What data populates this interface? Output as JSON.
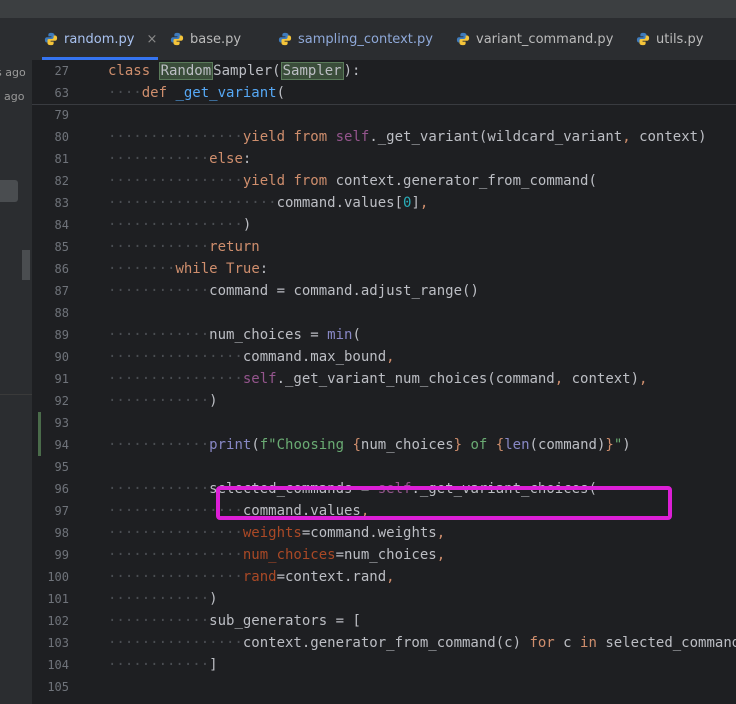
{
  "sidebar": {
    "ago_1": "s ago",
    "ago_2": "ago"
  },
  "tabs": [
    {
      "label": "random.py",
      "active": true,
      "close": "×"
    },
    {
      "label": "base.py"
    },
    {
      "label": "sampling_context.py"
    },
    {
      "label": "variant_command.py"
    },
    {
      "label": "utils.py"
    }
  ],
  "sticky": [
    {
      "num": "27",
      "text": "class RandomSampler(Sampler):"
    },
    {
      "num": "63",
      "text": "def _get_variant("
    }
  ],
  "lines": [
    {
      "num": "79",
      "text": ""
    },
    {
      "num": "80",
      "text": "yield from self._get_variant(wildcard_variant, context)"
    },
    {
      "num": "81",
      "text": "else:"
    },
    {
      "num": "82",
      "text": "yield from context.generator_from_command("
    },
    {
      "num": "83",
      "text": "command.values[0],"
    },
    {
      "num": "84",
      "text": ")"
    },
    {
      "num": "85",
      "text": "return"
    },
    {
      "num": "86",
      "text": "while True:"
    },
    {
      "num": "87",
      "text": "command = command.adjust_range()"
    },
    {
      "num": "88",
      "text": ""
    },
    {
      "num": "89",
      "text": "num_choices = min("
    },
    {
      "num": "90",
      "text": "command.max_bound,"
    },
    {
      "num": "91",
      "text": "self._get_variant_num_choices(command, context),"
    },
    {
      "num": "92",
      "text": ")"
    },
    {
      "num": "93",
      "text": ""
    },
    {
      "num": "94",
      "text": "print(f\"Choosing {num_choices} of {len(command)}\")"
    },
    {
      "num": "95",
      "text": ""
    },
    {
      "num": "96",
      "text": "selected_commands = self._get_variant_choices("
    },
    {
      "num": "97",
      "text": "command.values,"
    },
    {
      "num": "98",
      "text": "weights=command.weights,"
    },
    {
      "num": "99",
      "text": "num_choices=num_choices,"
    },
    {
      "num": "100",
      "text": "rand=context.rand,"
    },
    {
      "num": "101",
      "text": ")"
    },
    {
      "num": "102",
      "text": "sub_generators = ["
    },
    {
      "num": "103",
      "text": "context.generator_from_command(c) for c in selected_commands"
    },
    {
      "num": "104",
      "text": "]"
    },
    {
      "num": "105",
      "text": ""
    }
  ],
  "colors": {
    "highlight": "#dc1fd6",
    "tab_underline": "#3574f0"
  },
  "icons": {
    "tab_file": "python-icon"
  }
}
